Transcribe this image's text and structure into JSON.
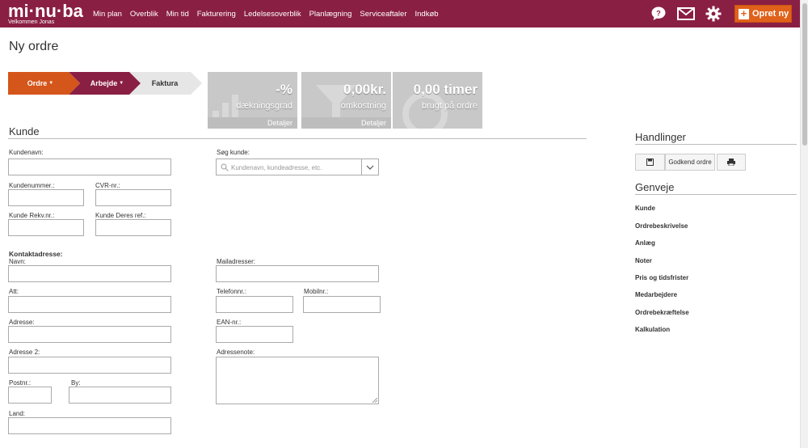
{
  "app": {
    "logo": "mi·nu·ba",
    "welcome": "Velkommen Jonas",
    "nav": [
      "Min plan",
      "Overblik",
      "Min tid",
      "Fakturering",
      "Ledelsesoverblik",
      "Planlægning",
      "Serviceaftaler",
      "Indkøb"
    ],
    "create_label": "Opret ny"
  },
  "page": {
    "title": "Ny ordre"
  },
  "steps": [
    {
      "label": "Ordre"
    },
    {
      "label": "Arbejde"
    },
    {
      "label": "Faktura"
    }
  ],
  "stats": [
    {
      "value": "-%",
      "label": "dækningsgrad",
      "details": "Detaljer"
    },
    {
      "value": "0,00kr.",
      "label": "omkostning",
      "details": "Detaljer"
    },
    {
      "value": "0,00 timer",
      "label": "brugt på ordre"
    }
  ],
  "customer": {
    "heading": "Kunde",
    "name_label": "Kundenavn:",
    "search_label": "Søg kunde:",
    "search_placeholder": "Kundenavn, kundeadresse, etc.",
    "number_label": "Kundenummer.:",
    "cvr_label": "CVR-nr.:",
    "req_label": "Kunde Rekv.nr.:",
    "ref_label": "Kunde Deres ref.:"
  },
  "contact": {
    "heading": "Kontaktadresse:",
    "name_label": "Navn:",
    "mail_label": "Mailadresser:",
    "att_label": "Att:",
    "phone_label": "Telefonnr.:",
    "mobile_label": "Mobilnr.:",
    "address_label": "Adresse:",
    "ean_label": "EAN-nr.:",
    "address2_label": "Adresse 2:",
    "address_note_label": "Adressenote:",
    "zip_label": "Postnr.:",
    "city_label": "By:",
    "country_label": "Land:"
  },
  "actions": {
    "heading": "Handlinger",
    "approve_label": "Godkend ordre"
  },
  "shortcuts": {
    "heading": "Genveje",
    "items": [
      "Kunde",
      "Ordrebeskrivelse",
      "Anlæg",
      "Noter",
      "Pris og tidsfrister",
      "Medarbejdere",
      "Ordrebekræftelse",
      "Kalkulation"
    ]
  },
  "colors": {
    "brand": "#8a1f44",
    "accent": "#e0611a",
    "step_active": "#d4561a",
    "step_mid": "#8a1f44",
    "step_idle": "#e6e6e6"
  }
}
